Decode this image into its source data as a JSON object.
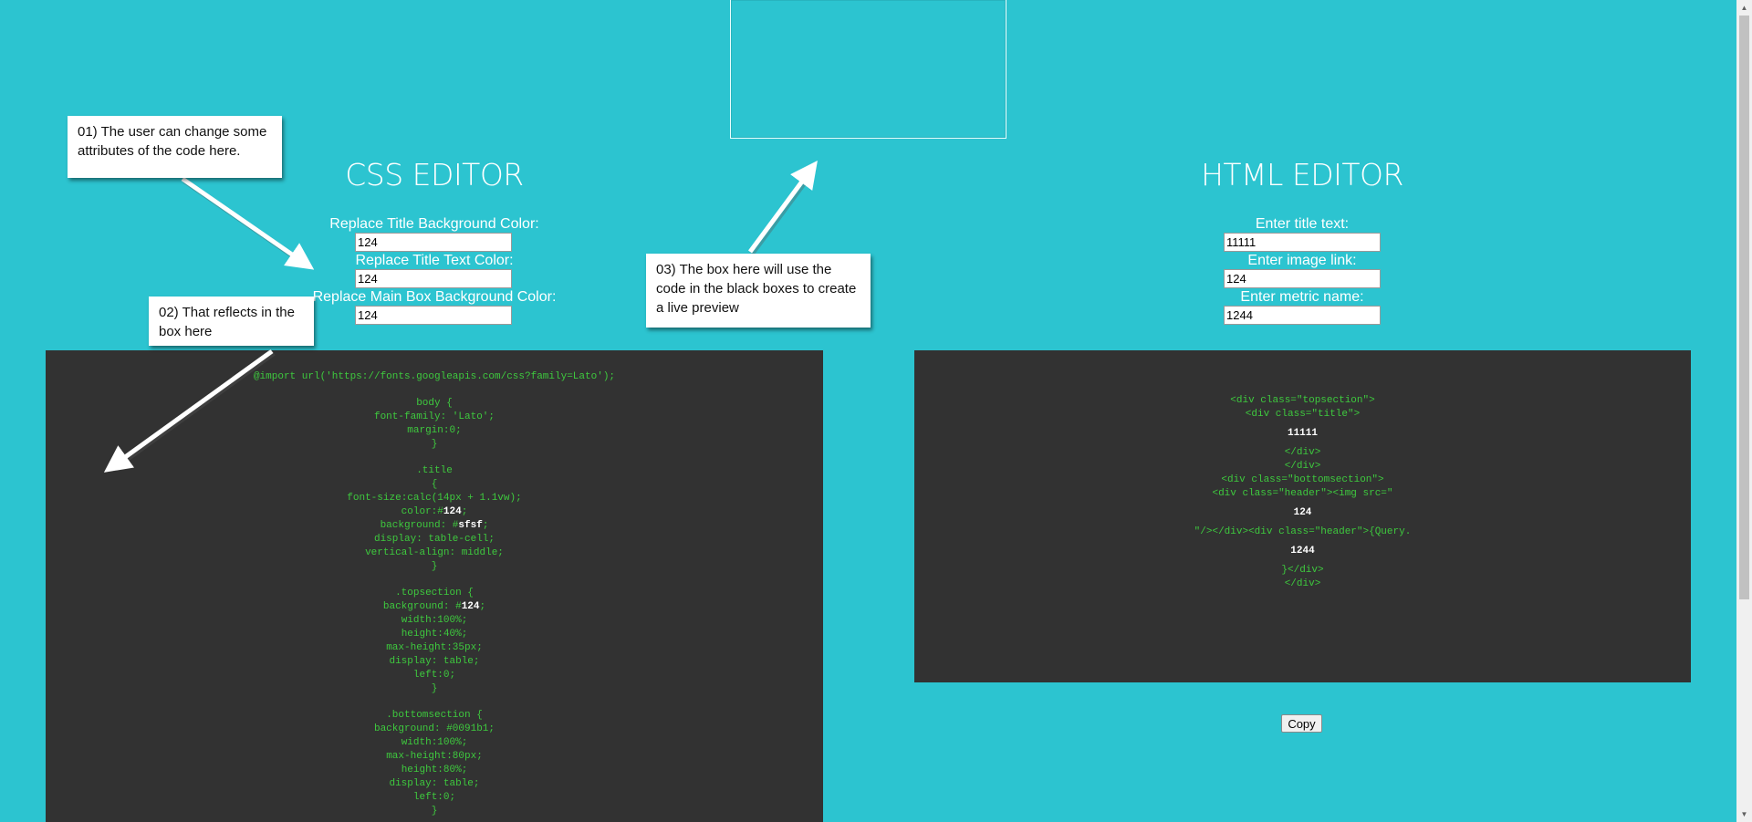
{
  "css_editor": {
    "title": "CSS EDITOR",
    "fields": [
      {
        "label": "Replace Title Background Color:",
        "value": "124"
      },
      {
        "label": "Replace Title Text Color:",
        "value": "124"
      },
      {
        "label": "Replace Main Box Background Color:",
        "value": "124"
      }
    ],
    "code": {
      "import": "@import url('https://fonts.googleapis.com/css?family=Lato');",
      "body_open": "body {",
      "font_family": "font-family: 'Lato';",
      "margin": "margin:0;",
      "close": "}",
      "title_selector": ".title",
      "open": "{",
      "font_size": "font-size:calc(14px + 1.1vw);",
      "color_prefix": "color:#",
      "color_value": "124",
      "semicolon": ";",
      "background_prefix": "background: #",
      "title_background_value": "sfsf",
      "display_table_cell": "display: table-cell;",
      "vertical_align": "vertical-align: middle;",
      "topsection_open": ".topsection {",
      "topsection_background_value": "124",
      "width": "width:100%;",
      "height_40": "height:40%;",
      "max_height_35": "max-height:35px;",
      "display_table": "display: table;",
      "left": "left:0;",
      "bottomsection_open": ".bottomsection {",
      "bottom_background": "background: #0091b1;",
      "max_height_80": "max-height:80px;",
      "height_80": "height:80%;"
    }
  },
  "html_editor": {
    "title": "HTML EDITOR",
    "fields": [
      {
        "label": "Enter title text:",
        "value": "11111"
      },
      {
        "label": "Enter image link:",
        "value": "124"
      },
      {
        "label": "Enter metric name:",
        "value": "1244"
      }
    ],
    "code": {
      "topsection": "<div class=\"topsection\">",
      "title": "<div class=\"title\">",
      "title_value": "11111",
      "close_div": "</div>",
      "bottomsection": "<div class=\"bottomsection\">",
      "header_img": "<div class=\"header\"><img src=\"",
      "image_value": "124",
      "header_query": "\"/></div><div class=\"header\">{Query.",
      "metric_value": "1244",
      "close_brace_div": "}</div>"
    },
    "copy_label": "Copy"
  },
  "callouts": {
    "c1": "01) The user can change some attributes of the code here.",
    "c2": "02) That reflects in the box here",
    "c3": "03) The box here will use the code in the black boxes to create a live preview"
  }
}
